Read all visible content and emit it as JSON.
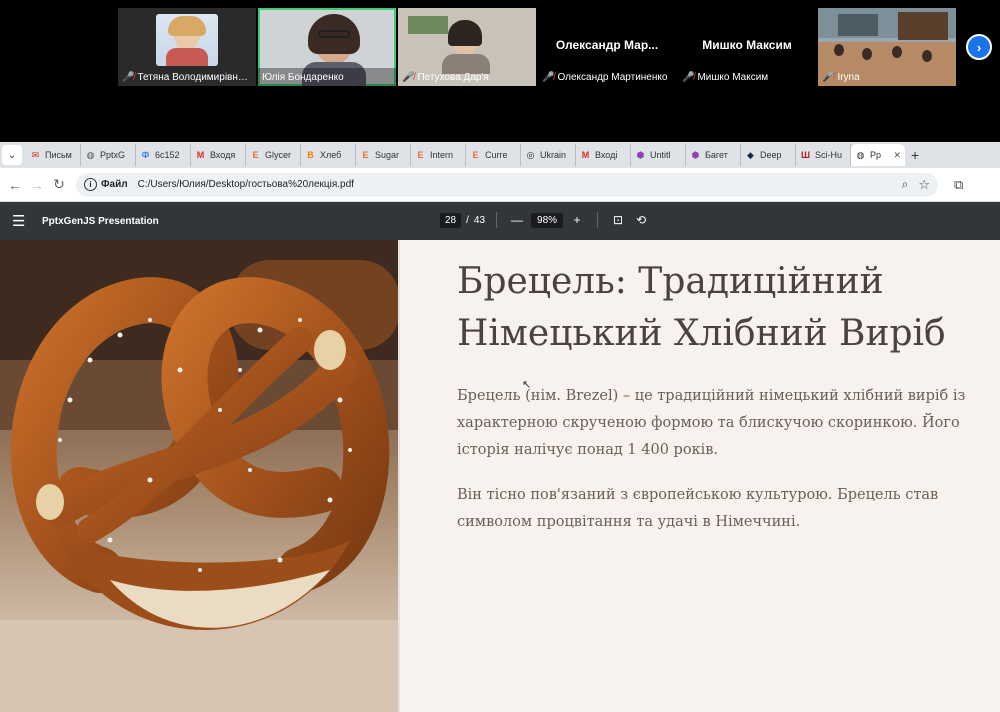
{
  "meeting": {
    "participants": [
      {
        "name": "Тетяна Володимирівна ...",
        "has_video": true,
        "muted": true,
        "active": false
      },
      {
        "name": "Юлія Бондаренко",
        "has_video": true,
        "muted": false,
        "active": true
      },
      {
        "name": "Петухова Дар'я",
        "has_video": true,
        "muted": true,
        "active": false
      },
      {
        "name": "Олександр Мартиненко",
        "center_label": "Олександр  Мар...",
        "has_video": false,
        "muted": true,
        "active": false
      },
      {
        "name": "Мишко Максим",
        "center_label": "Мишко Максим",
        "has_video": false,
        "muted": true,
        "active": false
      },
      {
        "name": "Iryna",
        "has_video": true,
        "muted": true,
        "active": false
      }
    ],
    "next_icon": "chevron-right-icon"
  },
  "browser": {
    "tabs": [
      {
        "label": "Письм",
        "icon": "mail-icon",
        "color": "#d93025"
      },
      {
        "label": "PptxG",
        "icon": "globe-icon",
        "color": "#555555"
      },
      {
        "label": "6c152",
        "icon": "doc-icon",
        "color": "#4285f4"
      },
      {
        "label": "Входя",
        "icon": "gmail-icon",
        "color": "#d93025"
      },
      {
        "label": "Glycer",
        "icon": "e-icon",
        "color": "#e8702a"
      },
      {
        "label": "Хлеб",
        "icon": "blogger-icon",
        "color": "#f57d00"
      },
      {
        "label": "Sugar",
        "icon": "e-icon",
        "color": "#e8702a"
      },
      {
        "label": "Intern",
        "icon": "e-icon",
        "color": "#e8702a"
      },
      {
        "label": "Curre",
        "icon": "e-icon",
        "color": "#e8702a"
      },
      {
        "label": "Ukrain",
        "icon": "openai-icon",
        "color": "#222222"
      },
      {
        "label": "Вході",
        "icon": "gmail-icon",
        "color": "#d93025"
      },
      {
        "label": "Untitl",
        "icon": "hex-icon",
        "color": "#8e44ad"
      },
      {
        "label": "Багет",
        "icon": "hex-icon",
        "color": "#8e44ad"
      },
      {
        "label": "Deep",
        "icon": "deepl-icon",
        "color": "#0f2b46"
      },
      {
        "label": "Sci-Hu",
        "icon": "scihub-icon",
        "color": "#b71c1c"
      }
    ],
    "active_tab": {
      "label": "Pp",
      "icon": "globe-icon"
    },
    "address": {
      "scheme_label": "Файл",
      "url": "C:/Users/Юлия/Desktop/гостьова%20лекція.pdf"
    }
  },
  "pdf": {
    "title": "PptxGenJS Presentation",
    "current_page": "28",
    "page_separator": "/",
    "total_pages": "43",
    "zoom": "98%"
  },
  "slide": {
    "title": "Брецель: Традиційний Німецький Хлібний Виріб",
    "paragraphs": [
      "Брецель (нім. Brezel) – це традиційний німецький хлібний виріб із характерною скрученою формою та блискучою скоринкою. Його історія налічує понад 1 400 років.",
      "Він тісно пов'язаний з європейською культурою. Брецель став символом процвітання та удачі в Німеччині."
    ]
  }
}
